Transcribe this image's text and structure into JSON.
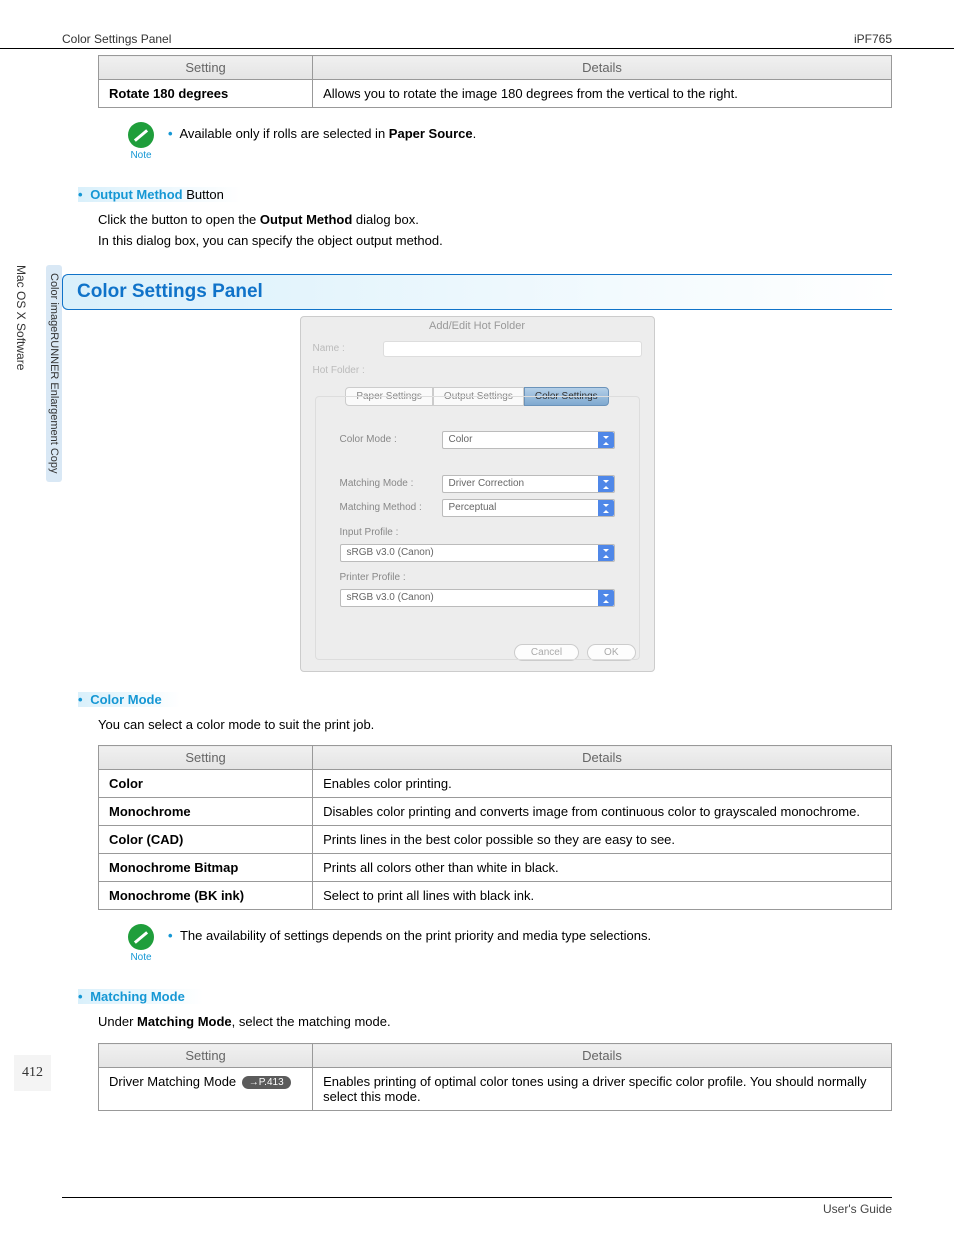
{
  "header": {
    "left": "Color Settings Panel",
    "right": "iPF765"
  },
  "sidebar": {
    "category": "Mac OS X Software",
    "topic": "Color imageRUNNER Enlargement Copy"
  },
  "page_number": "412",
  "footer": "User's Guide",
  "table1": {
    "columns": [
      "Setting",
      "Details"
    ],
    "rows": [
      {
        "setting": "Rotate 180 degrees",
        "details": "Allows you to rotate the image 180 degrees from the vertical to the right."
      }
    ]
  },
  "note1": {
    "label": "Note",
    "bullet_pre": "Available only if rolls are selected in ",
    "bullet_bold": "Paper Source",
    "bullet_post": "."
  },
  "output_method": {
    "title_bold": "Output Method",
    "title_trail": " Button",
    "line1_pre": "Click the button to open the ",
    "line1_bold": "Output Method",
    "line1_post": " dialog box.",
    "line2": "In this dialog box, you can specify the object output method."
  },
  "panel_title": "Color Settings Panel",
  "dialog": {
    "title": "Add/Edit Hot Folder",
    "name_label": "Name :",
    "hotfolder_label": "Hot Folder :",
    "tabs": [
      "Paper Settings",
      "Output Settings",
      "Color Settings"
    ],
    "colormode_label": "Color Mode :",
    "colormode_value": "Color",
    "matchingmode_label": "Matching Mode :",
    "matchingmode_value": "Driver Correction",
    "matchingmethod_label": "Matching Method :",
    "matchingmethod_value": "Perceptual",
    "inputprofile_label": "Input Profile :",
    "inputprofile_value": "sRGB v3.0 (Canon)",
    "printerprofile_label": "Printer Profile :",
    "printerprofile_value": "sRGB v3.0 (Canon)",
    "cancel": "Cancel",
    "ok": "OK"
  },
  "colormode": {
    "title": "Color Mode",
    "intro": "You can select a color mode to suit the print job.",
    "columns": [
      "Setting",
      "Details"
    ],
    "rows": [
      {
        "s": "Color",
        "d": "Enables color printing."
      },
      {
        "s": "Monochrome",
        "d": "Disables color printing and converts image from continuous color to grayscaled monochrome."
      },
      {
        "s": "Color (CAD)",
        "d": "Prints lines in the best color possible so they are easy to see."
      },
      {
        "s": "Monochrome Bitmap",
        "d": "Prints all colors other than white in black."
      },
      {
        "s": "Monochrome (BK ink)",
        "d": "Select to print all lines with black ink."
      }
    ]
  },
  "note2": {
    "label": "Note",
    "text": "The availability of settings depends on the print priority and media type selections."
  },
  "matchingmode": {
    "title": "Matching Mode",
    "intro_pre": "Under ",
    "intro_bold": "Matching Mode",
    "intro_post": ", select the matching mode.",
    "columns": [
      "Setting",
      "Details"
    ],
    "row_setting": "Driver Matching Mode",
    "row_pill": "→P.413",
    "row_details": "Enables printing of optimal color tones using a driver specific color profile. You should normally select this mode."
  }
}
